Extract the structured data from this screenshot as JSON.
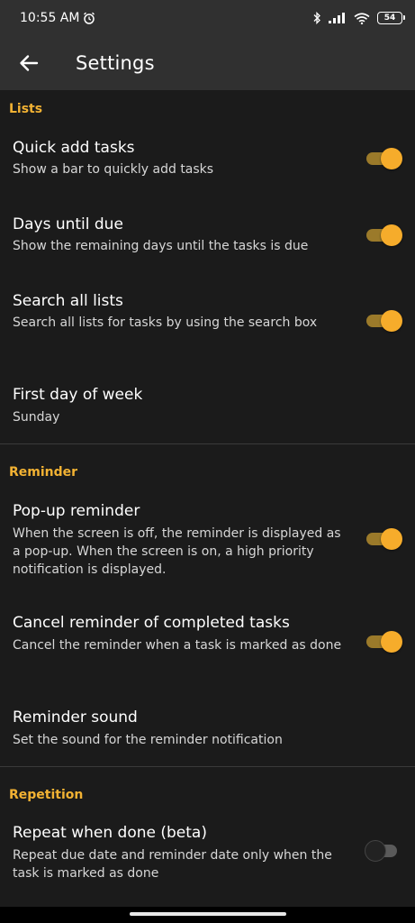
{
  "status": {
    "time": "10:55 AM",
    "battery": "54"
  },
  "app_bar": {
    "title": "Settings"
  },
  "sections": {
    "lists": "Lists",
    "reminder": "Reminder",
    "repetition": "Repetition"
  },
  "prefs": {
    "quick_add": {
      "title": "Quick add tasks",
      "summary": "Show a bar to quickly add tasks",
      "enabled": true
    },
    "days_until_due": {
      "title": "Days until due",
      "summary": "Show the remaining days until the tasks is due",
      "enabled": true
    },
    "search_all": {
      "title": "Search all lists",
      "summary": "Search all lists for tasks by using the search box",
      "enabled": true
    },
    "first_day": {
      "title": "First day of week",
      "summary": "Sunday"
    },
    "popup_reminder": {
      "title": "Pop-up reminder",
      "summary": "When the screen is off, the reminder is displayed as a pop-up. When the screen is on, a high priority notification is displayed.",
      "enabled": true
    },
    "cancel_reminder": {
      "title": "Cancel reminder of completed tasks",
      "summary": "Cancel the reminder when a task is marked as done",
      "enabled": true
    },
    "reminder_sound": {
      "title": "Reminder sound",
      "summary": "Set the sound for the reminder notification"
    },
    "repeat_done": {
      "title": "Repeat when done (beta)",
      "summary": "Repeat due date and reminder date only when the task is marked as done",
      "enabled": false
    }
  },
  "colors": {
    "accent": "#f2b233",
    "switch_on": "#f6ac2b",
    "background": "#1b1b1b",
    "app_bar": "#303030"
  }
}
